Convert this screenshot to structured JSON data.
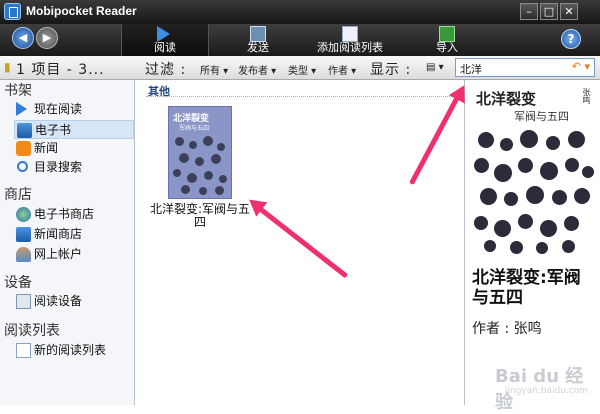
{
  "window": {
    "title": "Mobipocket Reader"
  },
  "toolbar": {
    "read": "阅读",
    "send": "发送",
    "add_list": "添加阅读列表",
    "import": "导入"
  },
  "filter": {
    "items": "1 项目 - 3...",
    "filter_label": "过滤 :",
    "all": "所有",
    "publisher": "发布者",
    "type": "类型",
    "author": "作者",
    "display_label": "显示 :",
    "search_value": "北洋"
  },
  "sidebar": {
    "bookshelf": "书架",
    "now_reading": "现在阅读",
    "ebooks": "电子书",
    "news": "新闻",
    "catalog_search": "目录搜索",
    "store": "商店",
    "ebook_store": "电子书商店",
    "news_store": "新闻商店",
    "online_account": "网上帐户",
    "devices": "设备",
    "reading_device": "阅读设备",
    "reading_lists": "阅读列表",
    "new_reading_list": "新的阅读列表"
  },
  "main": {
    "group_header": "其他",
    "book_title": "北洋裂变:军阀与五四",
    "cover_title": "北洋裂变",
    "cover_subtitle": "军阀与五四"
  },
  "preview": {
    "cover_title": "北洋裂变",
    "cover_subtitle": "军阀与五四",
    "cover_author": "张鸣",
    "title": "北洋裂变:军阀与五四",
    "author": "作者 : 张鸣"
  },
  "watermark": {
    "text": "Bai du 经验",
    "sub": "jingyan.baidu.com"
  },
  "colors": {
    "accent": "#f0306e",
    "titlebar": "#1e1e1e",
    "selected": "#d6e6f7"
  }
}
